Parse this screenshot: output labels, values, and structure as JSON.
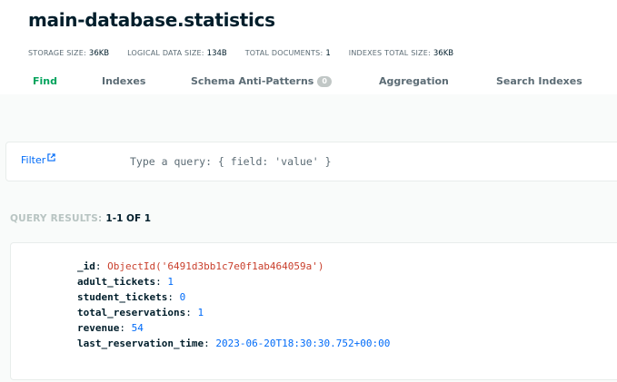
{
  "header": {
    "title": "main-database.statistics",
    "stats": [
      {
        "label": "STORAGE SIZE:",
        "value": "36KB"
      },
      {
        "label": "LOGICAL DATA SIZE:",
        "value": "134B"
      },
      {
        "label": "TOTAL DOCUMENTS:",
        "value": "1"
      },
      {
        "label": "INDEXES TOTAL SIZE:",
        "value": "36KB"
      }
    ]
  },
  "tabs": [
    {
      "label": "Find",
      "active": true
    },
    {
      "label": "Indexes"
    },
    {
      "label": "Schema Anti-Patterns",
      "badge": "0"
    },
    {
      "label": "Aggregation"
    },
    {
      "label": "Search Indexes"
    }
  ],
  "filter": {
    "label": "Filter",
    "placeholder": "Type a query: { field: 'value' }"
  },
  "results": {
    "label": "QUERY RESULTS:",
    "count": "1-1 OF 1"
  },
  "document": {
    "fields": [
      {
        "key": "_id",
        "value": "ObjectId('6491d3bb1c7e0f1ab464059a')",
        "type": "objectid"
      },
      {
        "key": "adult_tickets",
        "value": "1",
        "type": "number"
      },
      {
        "key": "student_tickets",
        "value": "0",
        "type": "number"
      },
      {
        "key": "total_reservations",
        "value": "1",
        "type": "number"
      },
      {
        "key": "revenue",
        "value": "54",
        "type": "number"
      },
      {
        "key": "last_reservation_time",
        "value": "2023-06-20T18:30:30.752+00:00",
        "type": "date"
      }
    ]
  },
  "colors": {
    "accent_green": "#00a35c",
    "link_blue": "#016bf8",
    "objectid_red": "#c93f2c",
    "text_dark": "#001e2b",
    "text_muted": "#5c6c75"
  }
}
